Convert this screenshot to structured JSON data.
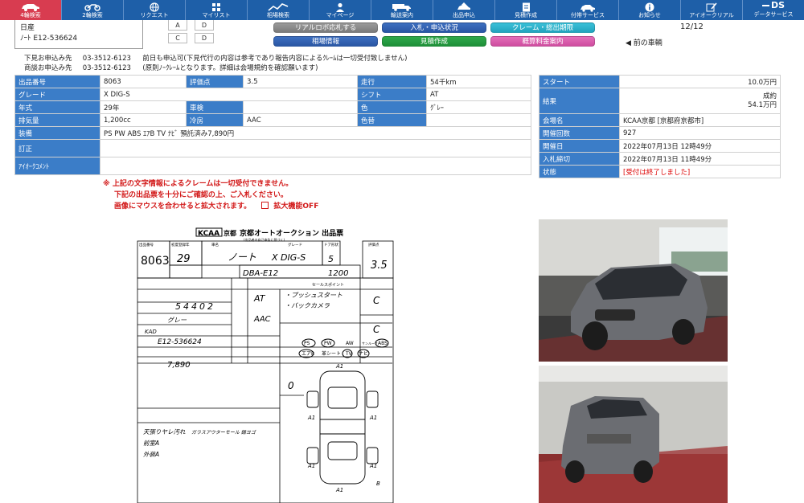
{
  "nav": [
    {
      "label": "4輪検索",
      "icon": "car-icon",
      "active": true
    },
    {
      "label": "2輪検索",
      "icon": "motorbike-icon"
    },
    {
      "label": "リクエスト",
      "icon": "globe-icon"
    },
    {
      "label": "マイリスト",
      "icon": "grid-list-icon"
    },
    {
      "label": "相場検索",
      "icon": "chart-icon"
    },
    {
      "label": "マイページ",
      "icon": "person-icon"
    },
    {
      "label": "輸送案内",
      "icon": "truck-icon"
    },
    {
      "label": "出品申込",
      "icon": "car-upload-icon"
    },
    {
      "label": "見積作成",
      "icon": "document-icon"
    },
    {
      "label": "付帯サービス",
      "icon": "service-car-icon"
    },
    {
      "label": "お知らせ",
      "icon": "info-icon"
    },
    {
      "label": "アイオークリアル",
      "icon": "pencil-note-icon"
    },
    {
      "label": "データサービス",
      "icon": "ds-icon",
      "badge": "DS"
    }
  ],
  "vehicle": {
    "maker": "日産",
    "model_chassis": "ﾉｰﾄ E12-536624"
  },
  "grade_boxes": [
    "A",
    "D",
    "C",
    "D"
  ],
  "buttons": {
    "realtime": "リアルロボ応札する",
    "bid_status": "入札・申込状況",
    "claim": "クレーム・総出期限",
    "market": "相場情報",
    "quote": "見積作成",
    "guide": "概算料金案内"
  },
  "pager": "12/12",
  "prev_link": "前の車輌",
  "contacts": [
    {
      "label": "下見お申込み先",
      "phone": "03-3512-6123",
      "note": "前日も申込可(下見代行の内容は参考であり報告内容によるｸﾚｰﾑは一切受付致しません)"
    },
    {
      "label": "商談お申込み先",
      "phone": "03-3512-6123",
      "note": "(原則ﾉｰｸﾚｰﾑとなります。詳細は会場規約を確認願います)"
    }
  ],
  "info": {
    "lot_no_label": "出品番号",
    "lot_no": "8063",
    "score_label": "評価点",
    "score": "3.5",
    "mileage_label": "走行",
    "mileage": "54千km",
    "grade_label": "グレード",
    "grade": "X DIG-S",
    "shift_label": "シフト",
    "shift": "AT",
    "year_label": "年式",
    "year": "29年",
    "inspection_label": "車検",
    "inspection": "",
    "color_label": "色",
    "color": "ｸﾞﾚｰ",
    "displacement_label": "排気量",
    "displacement": "1,200cc",
    "aircon_label": "冷房",
    "aircon": "AAC",
    "color_no_label": "色替",
    "color_no": "",
    "equipment_label": "装備",
    "equipment": "PS PW ABS ｴｱB TV ﾅﾋﾞ 預託済み7,890円",
    "correction_label": "訂正",
    "correction": "",
    "comment_label": "ｱｲｵｰｸｺﾒﾝﾄ",
    "comment": ""
  },
  "side": {
    "start_label": "スタート",
    "start": "10.0万円",
    "result_label": "結果",
    "result_status": "成約",
    "result_price": "54.1万円",
    "venue_label": "会場名",
    "venue": "KCAA京都 [京都府京都市]",
    "session_label": "開催回数",
    "session": "927",
    "date_label": "開催日",
    "date": "2022年07月13日 12時49分",
    "deadline_label": "入札締切",
    "deadline": "2022年07月13日 11時49分",
    "state_label": "状態",
    "state": "[受付は終了しました]"
  },
  "warnings": {
    "line1": "※ 上記の文字情報によるクレームは一切受付できません。",
    "line2": "下記の出品票を十分にご確認の上、ご入札ください。",
    "line3": "画像にマウスを合わせると拡大されます。",
    "zoom_off": "拡大機能OFF"
  },
  "sheet": {
    "logo": "KCAA",
    "logo_sub": "京都",
    "title": "京都オートオークション 出品票",
    "small_note": "(出品者の自己申告に基づく)",
    "lot_no_header": "出品番号",
    "lot_no": "8063",
    "year_header": "初度登録年",
    "year": "29",
    "name_header": "車名",
    "name": "ノート",
    "grade_header": "グレード",
    "grade": "X DIG-S",
    "door_header": "ドア形状",
    "door": "5",
    "score_header": "評価点",
    "score": "3.5",
    "type": "DBA-E12",
    "cc": "1200",
    "mileage_digits": "54402",
    "shift": "AT",
    "ac": "AAC",
    "color": "グレー",
    "color_code": "KAD",
    "chassis": "E12-536624",
    "recycle": "7,890",
    "sales_points_header": "セールスポイント",
    "sales_point_1": "・プッシュスタート",
    "sales_point_2": "・バックカメラ",
    "interior_grade": "C",
    "exterior_grade": "C",
    "equip": [
      "PS",
      "PW",
      "AW",
      "サンルーフ",
      "エアB",
      "革シート",
      "TV",
      "ナビ",
      "ABS"
    ],
    "notes": [
      "天張りヤレ汚れ",
      "前室A",
      "外装A"
    ],
    "note_right": "ガラスアウターモール 錆ヨゴ",
    "key_count": "0"
  },
  "photos": [
    {
      "name": "front-photo",
      "desc": "front-left exterior photo"
    },
    {
      "name": "rear-photo",
      "desc": "rear exterior photo"
    }
  ]
}
